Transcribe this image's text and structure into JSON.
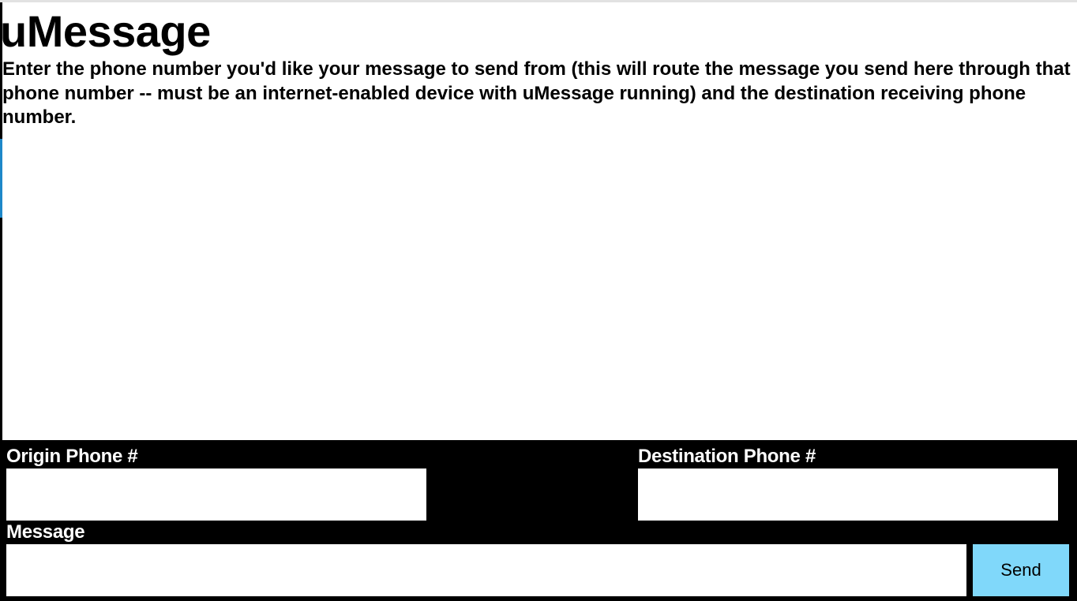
{
  "header": {
    "title": "uMessage",
    "instructions": "Enter the phone number you'd like your message to send from (this will route the message you send here through that phone number -- must be an internet-enabled device with uMessage running) and the destination receiving phone number."
  },
  "form": {
    "origin": {
      "label": "Origin Phone #",
      "value": "",
      "placeholder": ""
    },
    "destination": {
      "label": "Destination Phone #",
      "value": "",
      "placeholder": ""
    },
    "message": {
      "label": "Message",
      "value": "",
      "placeholder": ""
    },
    "send_label": "Send"
  },
  "colors": {
    "panel_background": "#000000",
    "send_button": "#80d8fa",
    "label_text": "#ffffff"
  }
}
